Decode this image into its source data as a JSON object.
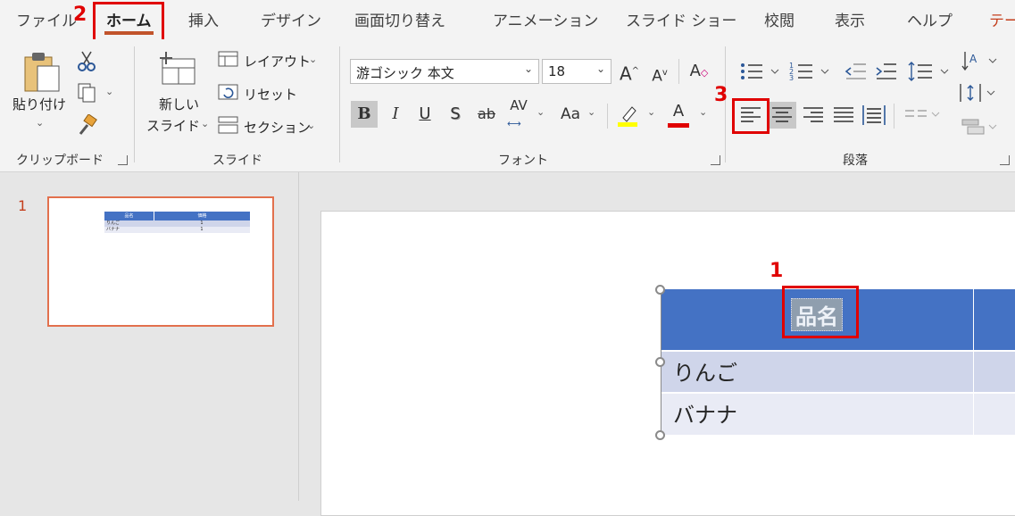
{
  "tabs": [
    "ファイル",
    "ホーム",
    "挿入",
    "デザイン",
    "画面切り替え",
    "アニメーション",
    "スライド ショー",
    "校閲",
    "表示",
    "ヘルプ",
    "テー"
  ],
  "clipboard": {
    "paste_label_1": "貼り付け",
    "group_label": "クリップボード"
  },
  "slides_group": {
    "new_slide_1": "新しい",
    "new_slide_2": "スライド",
    "layout": "レイアウト",
    "reset": "リセット",
    "section": "セクション",
    "group_label": "スライド"
  },
  "font": {
    "name": "游ゴシック 本文",
    "size": "18",
    "group_label": "フォント",
    "case_label": "Aa"
  },
  "paragraph": {
    "group_label": "段落"
  },
  "annotations": {
    "m1": "1",
    "m2": "2",
    "m3": "3"
  },
  "thumbnail": {
    "number": "1",
    "h1": "品名",
    "h2": "価格",
    "r1": "りんご",
    "r1b": "1",
    "r2": "バナナ",
    "r2b": "1"
  },
  "table": {
    "header": "品名",
    "row1": "りんご",
    "row2": "バナナ"
  },
  "colors": {
    "accent_red": "#e00000",
    "table_header": "#4472c4",
    "row_odd": "#cfd5ea",
    "row_even": "#e9ebf5",
    "tab_underline": "#c1532b"
  }
}
